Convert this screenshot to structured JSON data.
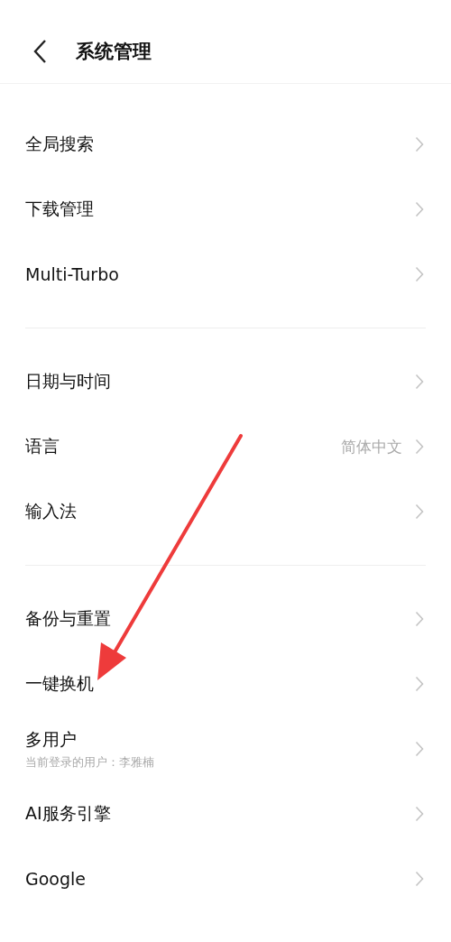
{
  "header": {
    "title": "系统管理"
  },
  "groups": [
    {
      "items": [
        {
          "label": "全局搜索"
        },
        {
          "label": "下载管理"
        },
        {
          "label": "Multi-Turbo"
        }
      ]
    },
    {
      "items": [
        {
          "label": "日期与时间"
        },
        {
          "label": "语言",
          "value": "简体中文"
        },
        {
          "label": "输入法"
        }
      ]
    },
    {
      "items": [
        {
          "label": "备份与重置"
        },
        {
          "label": "一键换机"
        },
        {
          "label": "多用户",
          "subtitle": "当前登录的用户：李雅楠"
        },
        {
          "label": "AI服务引擎"
        },
        {
          "label": "Google"
        }
      ]
    }
  ],
  "annotation": {
    "kind": "arrow"
  }
}
